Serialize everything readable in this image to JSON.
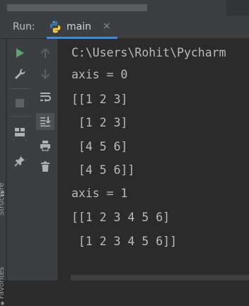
{
  "run_panel": {
    "label": "Run:",
    "tab": {
      "title": "main",
      "close": "×"
    }
  },
  "side_labels": {
    "structure": "Structure",
    "favorites": "Favorites"
  },
  "console": {
    "lines": [
      "C:\\Users\\Rohit\\Pycharm",
      "axis = 0",
      "[[1 2 3]",
      " [1 2 3]",
      " [4 5 6]",
      " [4 5 6]]",
      "axis = 1",
      "[[1 2 3 4 5 6]",
      " [1 2 3 4 5 6]]"
    ]
  },
  "colors": {
    "background": "#2b2b2b",
    "toolbar": "#3c3f41",
    "text": "#bbbbbb",
    "run_green": "#59a869",
    "tab_accent": "#4a88c7",
    "python_blue": "#3b77a8",
    "python_yellow": "#f0c846"
  },
  "icons": {
    "column1": [
      "run-icon",
      "wrench-icon",
      "stop-icon",
      "layout-icon",
      "pin-icon"
    ],
    "column2": [
      "arrow-up-icon",
      "arrow-down-icon",
      "soft-wrap-icon",
      "scroll-to-end-icon",
      "print-icon",
      "trash-icon"
    ]
  }
}
